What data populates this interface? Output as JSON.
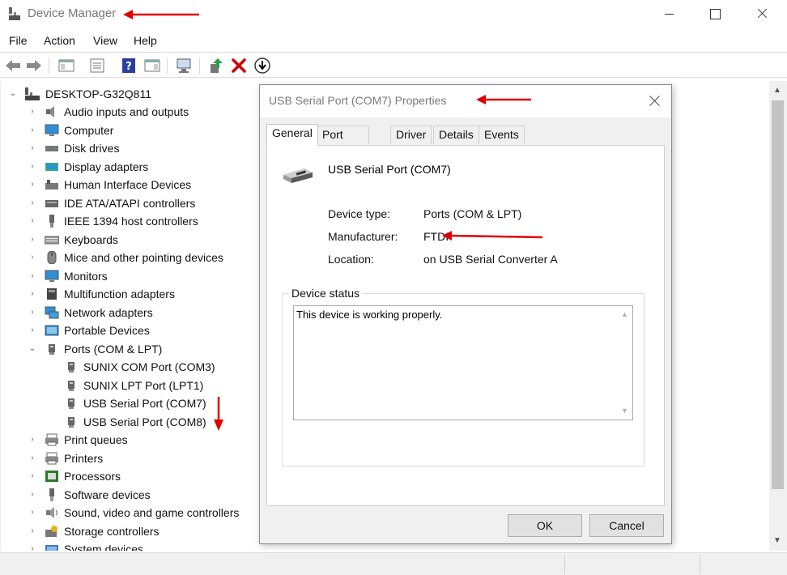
{
  "window": {
    "title": "Device Manager"
  },
  "menu": [
    "File",
    "Action",
    "View",
    "Help"
  ],
  "toolbar_icons": [
    "back-arrow-icon",
    "forward-arrow-icon",
    "show-hide-console-tree-icon",
    "properties-icon",
    "help-icon",
    "action-pane-icon",
    "scan-hardware-icon",
    "update-driver-icon",
    "uninstall-icon",
    "disable-device-icon"
  ],
  "tree": {
    "root": "DESKTOP-G32Q811",
    "categories": [
      {
        "label": "Audio inputs and outputs",
        "icon": "speaker-icon"
      },
      {
        "label": "Computer",
        "icon": "monitor-icon"
      },
      {
        "label": "Disk drives",
        "icon": "disk-drive-icon"
      },
      {
        "label": "Display adapters",
        "icon": "display-adapter-icon"
      },
      {
        "label": "Human Interface Devices",
        "icon": "hid-icon"
      },
      {
        "label": "IDE ATA/ATAPI controllers",
        "icon": "ide-controller-icon"
      },
      {
        "label": "IEEE 1394 host controllers",
        "icon": "ieee1394-icon"
      },
      {
        "label": "Keyboards",
        "icon": "keyboard-icon"
      },
      {
        "label": "Mice and other pointing devices",
        "icon": "mouse-icon"
      },
      {
        "label": "Monitors",
        "icon": "monitor-icon"
      },
      {
        "label": "Multifunction adapters",
        "icon": "multifunction-icon"
      },
      {
        "label": "Network adapters",
        "icon": "network-icon"
      },
      {
        "label": "Portable Devices",
        "icon": "portable-device-icon"
      },
      {
        "label": "Ports (COM & LPT)",
        "icon": "port-icon",
        "expanded": true
      },
      {
        "label": "Print queues",
        "icon": "printer-icon"
      },
      {
        "label": "Printers",
        "icon": "printer-icon"
      },
      {
        "label": "Processors",
        "icon": "processor-icon"
      },
      {
        "label": "Software devices",
        "icon": "software-device-icon"
      },
      {
        "label": "Sound, video and game controllers",
        "icon": "sound-icon"
      },
      {
        "label": "Storage controllers",
        "icon": "storage-icon"
      },
      {
        "label": "System devices",
        "icon": "system-device-icon"
      }
    ],
    "ports_children": [
      "SUNIX COM Port (COM3)",
      "SUNIX LPT Port (LPT1)",
      "USB Serial Port (COM7)",
      "USB Serial Port (COM8)"
    ]
  },
  "dialog": {
    "title": "USB Serial Port (COM7) Properties",
    "tabs": [
      "General",
      "Port Settings",
      "Driver",
      "Details",
      "Events"
    ],
    "active_tab": "General",
    "device_name": "USB Serial Port (COM7)",
    "properties": [
      {
        "label": "Device type:",
        "value": "Ports (COM & LPT)"
      },
      {
        "label": "Manufacturer:",
        "value": "FTDI"
      },
      {
        "label": "Location:",
        "value": "on USB Serial Converter A"
      }
    ],
    "status_group": "Device status",
    "status_text": "This device is working properly.",
    "ok_label": "OK",
    "cancel_label": "Cancel"
  },
  "colors": {
    "annotation_arrow": "#e00000",
    "dialog_background": "#f0f0f0"
  }
}
